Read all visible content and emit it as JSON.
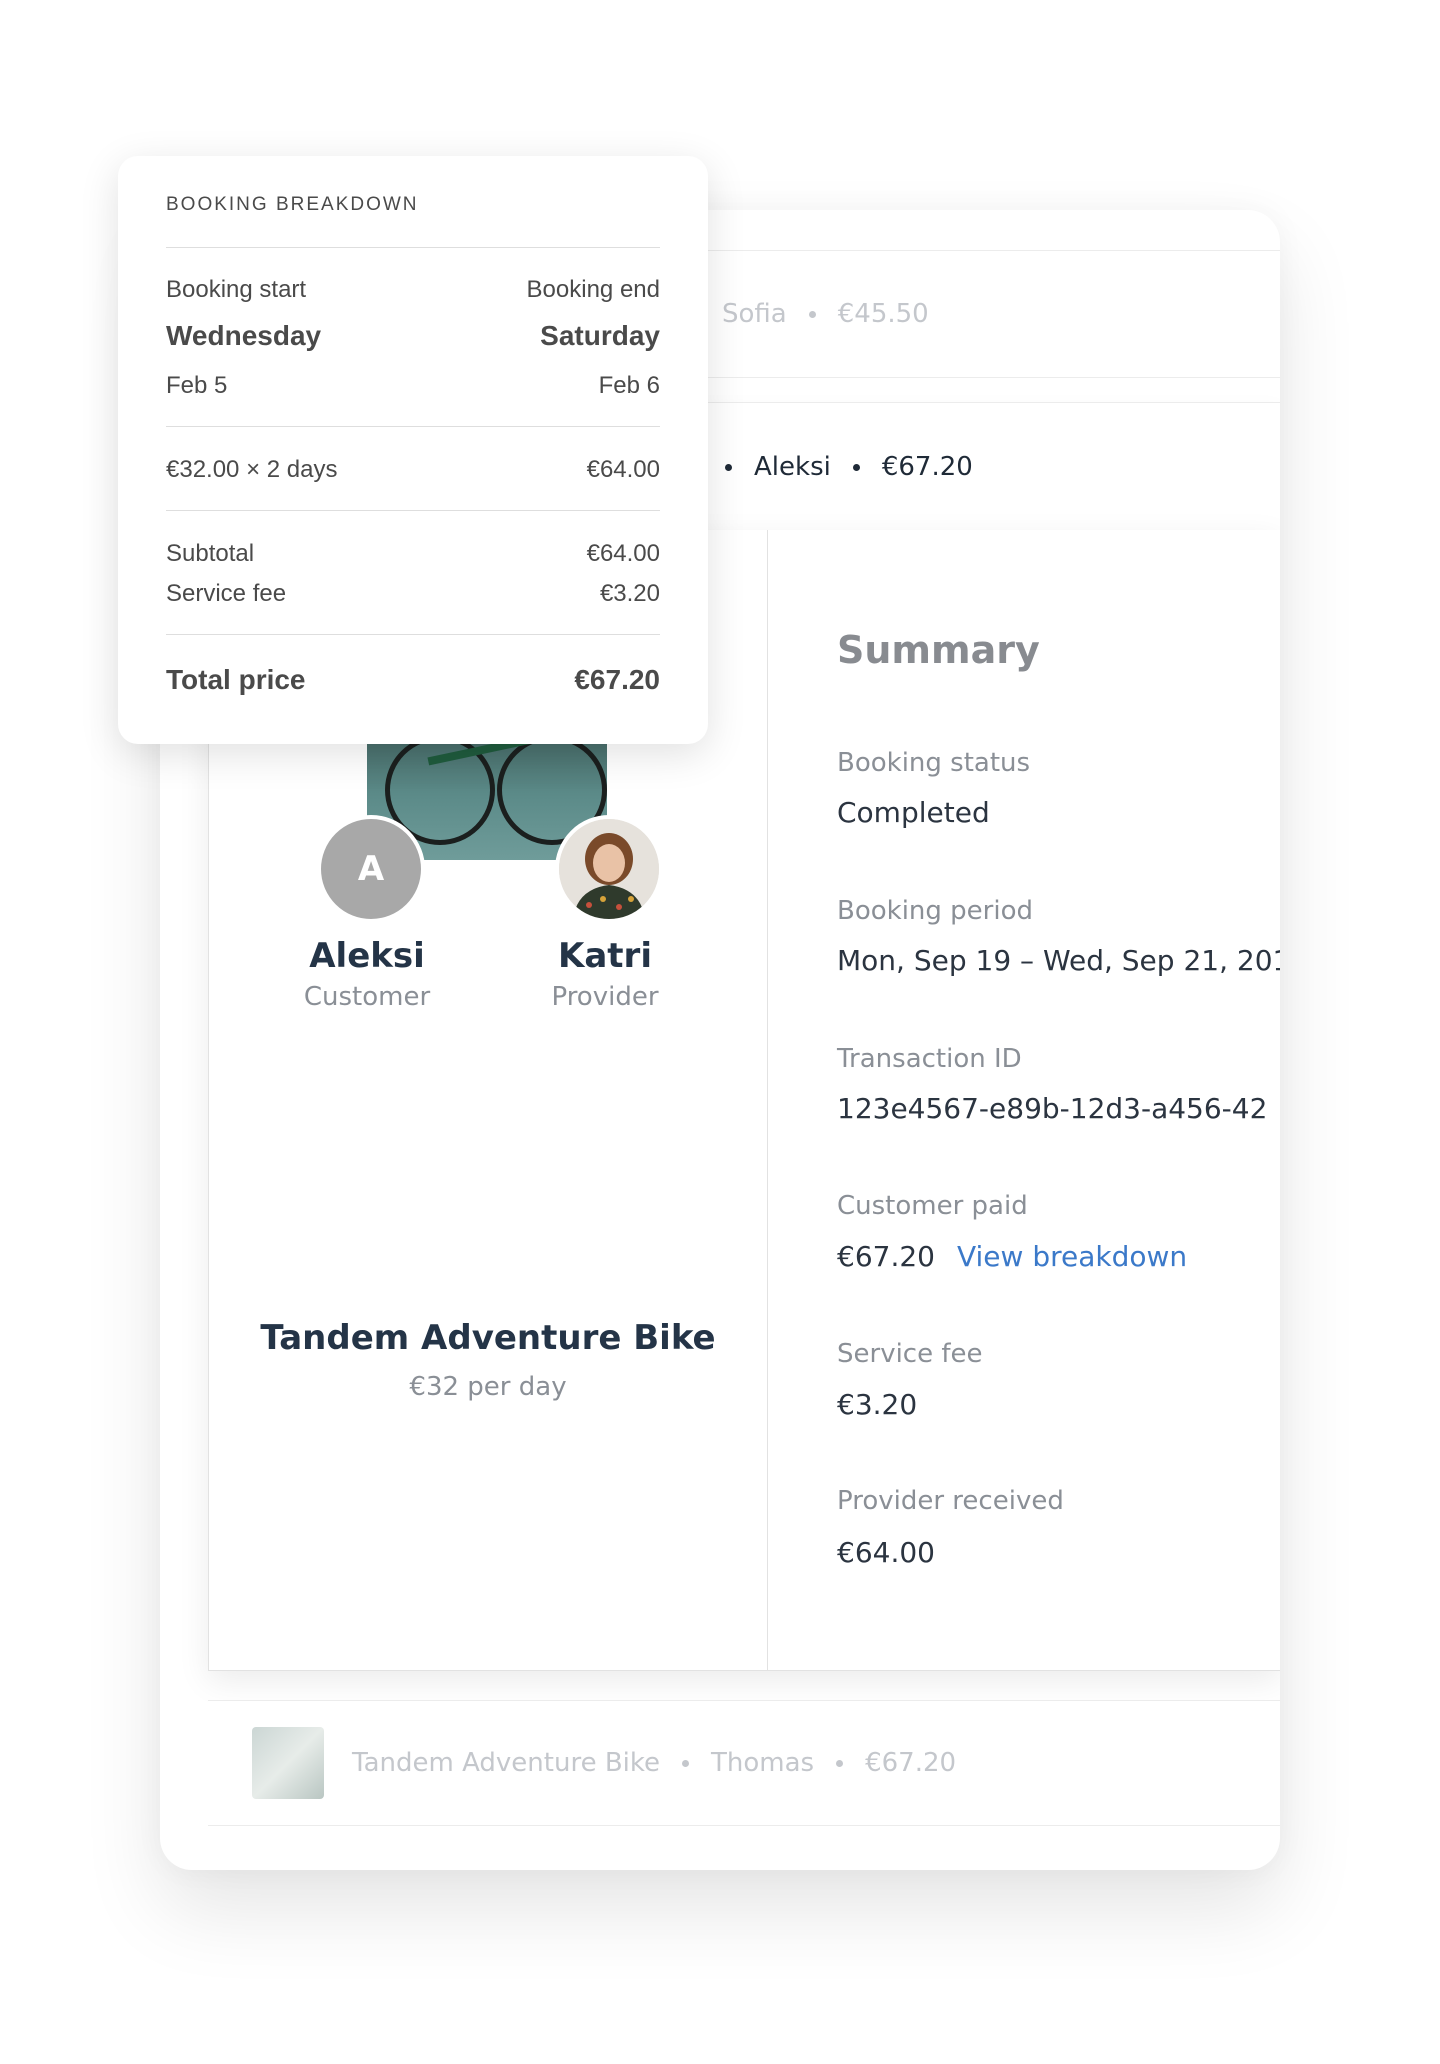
{
  "rows": {
    "row1": {
      "name": "Sofia",
      "price": "€45.50"
    },
    "row2": {
      "name": "Aleksi",
      "price": "€67.20"
    },
    "row3": {
      "listing": "Tandem Adventure Bike",
      "name": "Thomas",
      "price": "€67.20"
    }
  },
  "parties": {
    "customer": {
      "initial": "A",
      "name": "Aleksi",
      "role": "Customer"
    },
    "provider": {
      "name": "Katri",
      "role": "Provider"
    }
  },
  "listing": {
    "title": "Tandem Adventure Bike",
    "price": "€32 per day"
  },
  "summary": {
    "title": "Summary",
    "status_label": "Booking status",
    "status_value": "Completed",
    "period_label": "Booking period",
    "period_value": "Mon, Sep 19 – Wed, Sep 21, 201",
    "txid_label": "Transaction ID",
    "txid_value": "123e4567-e89b-12d3-a456-42",
    "paid_label": "Customer paid",
    "paid_value": "€67.20",
    "paid_link": "View breakdown",
    "fee_label": "Service fee",
    "fee_value": "€3.20",
    "received_label": "Provider received",
    "received_value": "€64.00"
  },
  "breakdown": {
    "title": "BOOKING BREAKDOWN",
    "start_label": "Booking start",
    "start_day": "Wednesday",
    "start_date": "Feb 5",
    "end_label": "Booking end",
    "end_day": "Saturday",
    "end_date": "Feb 6",
    "line_label": "€32.00 × 2 days",
    "line_value": "€64.00",
    "subtotal_label": "Subtotal",
    "subtotal_value": "€64.00",
    "fee_label": "Service fee",
    "fee_value": "€3.20",
    "total_label": "Total price",
    "total_value": "€67.20"
  }
}
